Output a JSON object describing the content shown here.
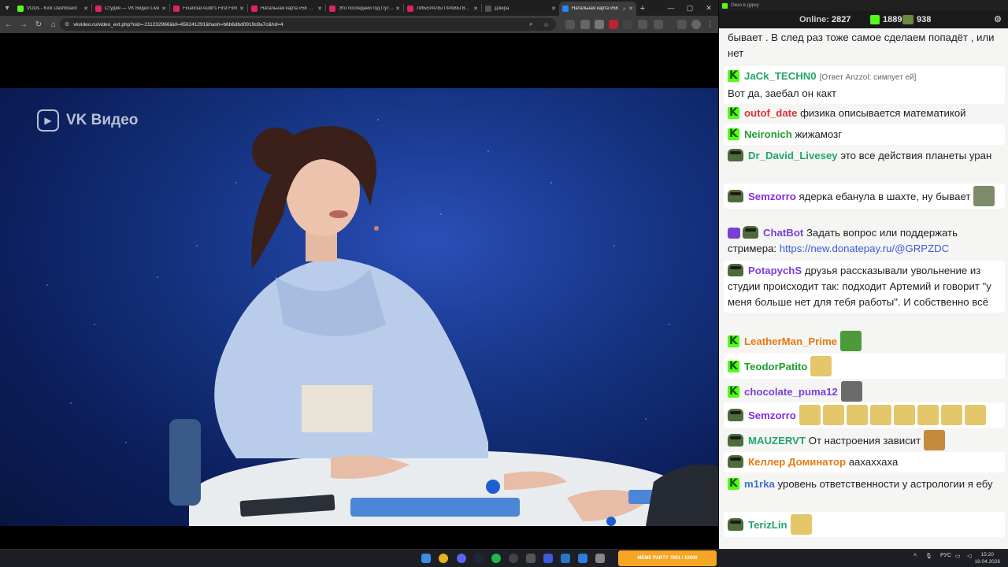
{
  "browser": {
    "tabs": [
      {
        "title": "VODs - Kick Dashboard",
        "favicon_color": "#53fc18",
        "active": false
      },
      {
        "title": "Студия — VK Видео Live",
        "favicon_color": "#e0245e",
        "active": false
      },
      {
        "title": "Financial Audit's First Film",
        "favicon_color": "#e0245e",
        "active": false
      },
      {
        "title": "Натальная карта #58 Анна",
        "favicon_color": "#e0245e",
        "active": false
      },
      {
        "title": "Это последний год Путина",
        "favicon_color": "#e0245e",
        "active": false
      },
      {
        "title": "ЛИБЕРАЛЫ ПРАВЫ ВО ВСЁМ",
        "favicon_color": "#e0245e",
        "active": false
      },
      {
        "title": "Дзюра",
        "favicon_color": "#555555",
        "active": false
      },
      {
        "title": "Натальная карта #58",
        "favicon_color": "#2787f5",
        "active": true
      }
    ],
    "url": "vkvideo.ru/video_ext.php?oid=-211232966&id=456241291&hash=b6b6dbd0919c8a7c&hd=4",
    "video": {
      "watermark": "VK Видео"
    }
  },
  "chat": {
    "window_title": "Окно в дурку",
    "online_label": "Online:",
    "online_count": "2827",
    "stat_kick": "1889",
    "stat_frog": "938",
    "messages": [
      {
        "user": "",
        "user_color": "#1f1f1f",
        "badge": "none",
        "text": "бывает . В след раз тоже самое сделаем попадёт , или нет",
        "reply": "",
        "link": "",
        "emotes": 0
      },
      {
        "user": "JaCk_TECHN0",
        "user_color": "#22a66a",
        "badge": "kick",
        "text": "Вот да, заебал он какт",
        "reply": "[Ответ Anzzol: симпует ей]",
        "link": "",
        "emotes": 0
      },
      {
        "user": "outof_date",
        "user_color": "#d6333b",
        "badge": "kick",
        "text": "физика описывается математикой",
        "reply": "",
        "link": "",
        "emotes": 0
      },
      {
        "user": "Neironich",
        "user_color": "#1f9e2e",
        "badge": "kick",
        "text": "жижамозг",
        "reply": "",
        "link": "",
        "emotes": 0
      },
      {
        "user": "Dr_David_Livesey",
        "user_color": "#22a66a",
        "badge": "frog",
        "text": "это все действия планеты уран",
        "reply": "",
        "link": "",
        "emotes": 0
      },
      {
        "user": "Semzorro",
        "user_color": "#8a2be2",
        "badge": "frog",
        "text": "ядерка ебанула в шахте, ну бывает",
        "reply": "",
        "link": "",
        "emotes": 1
      },
      {
        "user": "ChatBot",
        "user_color": "#7a3fd6",
        "badge": "bot",
        "text": "Задать вопрос или поддержать стримера:",
        "reply": "",
        "link": "https://new.donatepay.ru/@GRPZDC",
        "emotes": 0
      },
      {
        "user": "PotapychS",
        "user_color": "#7a3fd6",
        "badge": "frog",
        "text": "друзья рассказывали увольнение из студии происходит так: подходит Артемий и говорит \"у меня больше нет для тебя работы\". И собственно всё",
        "reply": "",
        "link": "",
        "emotes": 0
      },
      {
        "user": "LeatherMan_Prime",
        "user_color": "#e57a0e",
        "badge": "kick",
        "text": "",
        "reply": "",
        "link": "",
        "emotes": 1
      },
      {
        "user": "TeodorPatito",
        "user_color": "#1f9e2e",
        "badge": "kick",
        "text": "",
        "reply": "",
        "link": "",
        "emotes": 1
      },
      {
        "user": "chocolate_puma12",
        "user_color": "#7a3fd6",
        "badge": "kick",
        "text": "",
        "reply": "",
        "link": "",
        "emotes": 1
      },
      {
        "user": "Semzorro",
        "user_color": "#8a2be2",
        "badge": "frog",
        "text": "",
        "reply": "",
        "link": "",
        "emotes": 8
      },
      {
        "user": "MAUZERVT",
        "user_color": "#22a66a",
        "badge": "frog",
        "text": "От настроения зависит",
        "reply": "",
        "link": "",
        "emotes": 1
      },
      {
        "user": "Келлер Доминатор",
        "user_color": "#e57a0e",
        "badge": "frog",
        "text": "аахаххаха",
        "reply": "",
        "link": "",
        "emotes": 0
      },
      {
        "user": "m1rka",
        "user_color": "#3b73c9",
        "badge": "kick",
        "text": "уровень ответственности у астрологии я ебу",
        "reply": "",
        "link": "",
        "emotes": 0
      },
      {
        "user": "TerizLin",
        "user_color": "#22a66a",
        "badge": "frog",
        "text": "",
        "reply": "",
        "link": "",
        "emotes": 1
      }
    ]
  },
  "taskbar": {
    "meme_label": "MEME PARTY",
    "meme_sub": "7681 / 10000",
    "lang": "РУС",
    "time": "15:20",
    "date": "19.04.2026"
  }
}
